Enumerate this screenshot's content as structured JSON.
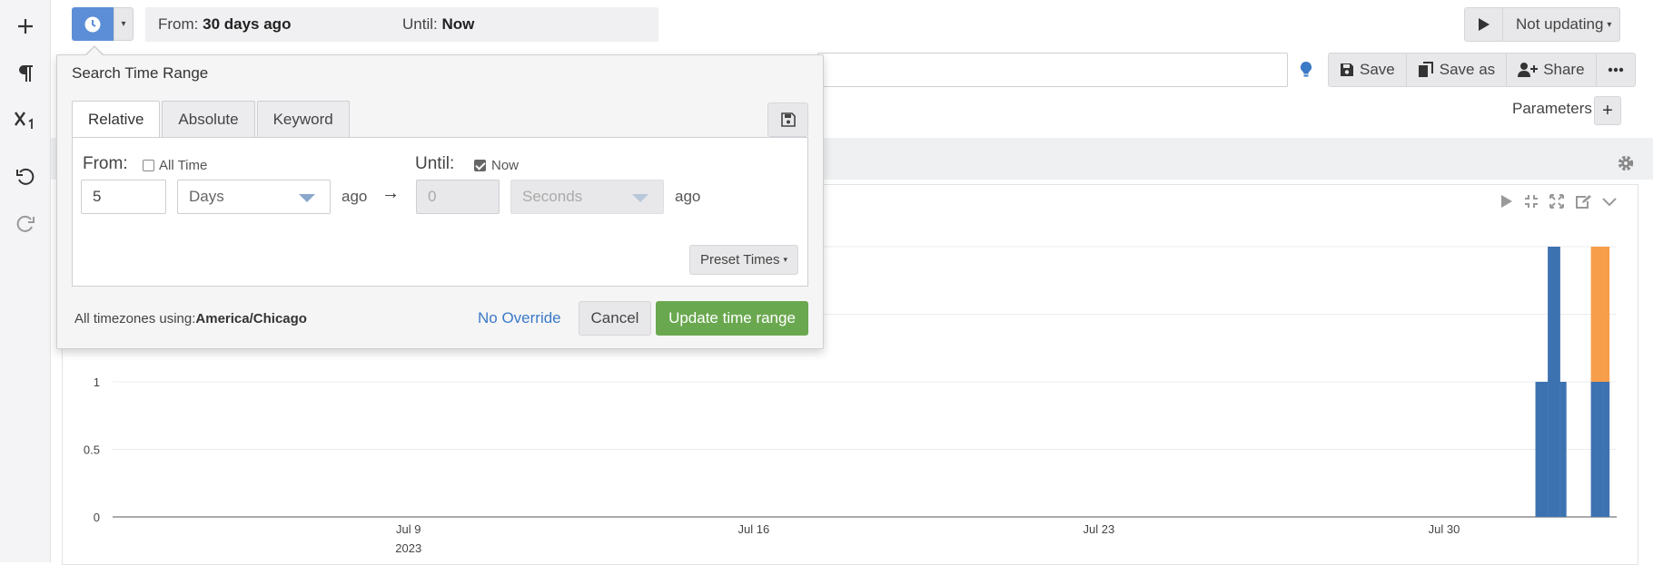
{
  "topbar": {
    "from_label": "From:",
    "from_value": "30 days ago",
    "until_label": "Until:",
    "until_value": "Now",
    "not_updating": "Not updating"
  },
  "actions": {
    "save": "Save",
    "save_as": "Save as",
    "share": "Share"
  },
  "parameters_label": "Parameters",
  "popover": {
    "title": "Search Time Range",
    "tabs": [
      "Relative",
      "Absolute",
      "Keyword"
    ],
    "from_label": "From:",
    "all_time_label": "All Time",
    "all_time_checked": false,
    "from_amount": "5",
    "from_unit": "Days",
    "ago": "ago",
    "until_label": "Until:",
    "now_label": "Now",
    "now_checked": true,
    "until_amount_placeholder": "0",
    "until_unit": "Seconds",
    "preset_times": "Preset Times",
    "timezone_prefix": "All timezones using:",
    "timezone_value": "America/Chicago",
    "no_override": "No Override",
    "cancel": "Cancel",
    "update": "Update time range"
  },
  "colors": {
    "accent": "#5b8ed6",
    "bar_blue": "#3d72b1",
    "bar_orange": "#f79e4a",
    "success": "#6aa84f",
    "link": "#3b7ac6"
  },
  "chart_data": {
    "type": "bar",
    "stacked": true,
    "x_ticks": [
      "Jul 9",
      "Jul 16",
      "Jul 23",
      "Jul 30"
    ],
    "x_tick_sub": "2023",
    "y_ticks": [
      "0",
      "0.5",
      "1"
    ],
    "ylim": [
      0,
      2
    ],
    "x_range": [
      "2023-07-03",
      "2023-08-02"
    ],
    "series": [
      {
        "color": "#3d72b1",
        "points": [
          {
            "x": "2023-07-31 22:00",
            "y": 1
          },
          {
            "x": "2023-08-01 01:00",
            "y": 1
          },
          {
            "x": "2023-08-01 04:00",
            "y": 2
          },
          {
            "x": "2023-08-01 07:00",
            "y": 2
          },
          {
            "x": "2023-08-01 10:00",
            "y": 1
          },
          {
            "x": "2023-08-02 01:00",
            "y": 1
          },
          {
            "x": "2023-08-02 04:00",
            "y": 1
          },
          {
            "x": "2023-08-02 07:00",
            "y": 1
          }
        ]
      },
      {
        "color": "#f79e4a",
        "points": [
          {
            "x": "2023-08-02 01:00",
            "y": 1
          },
          {
            "x": "2023-08-02 04:00",
            "y": 1
          },
          {
            "x": "2023-08-02 07:00",
            "y": 1
          }
        ]
      }
    ]
  }
}
